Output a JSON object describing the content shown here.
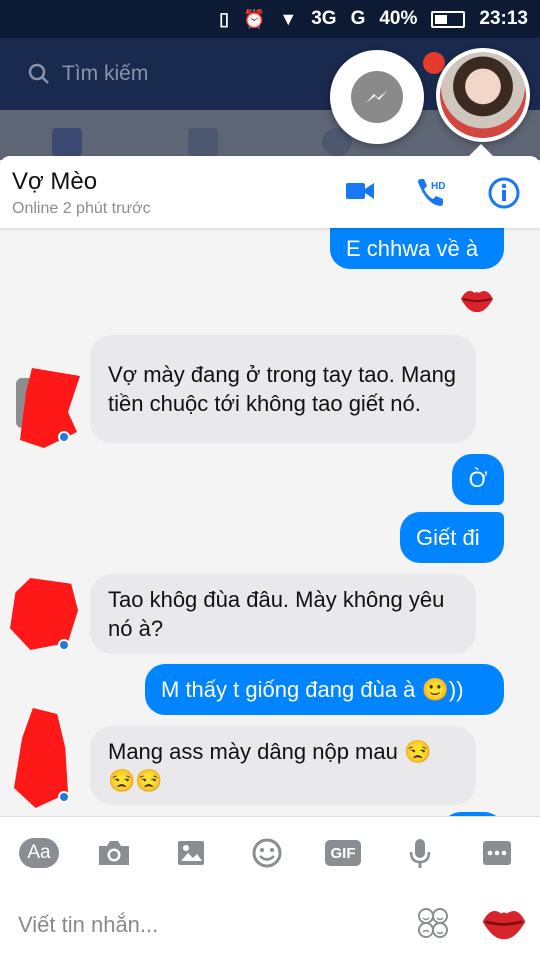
{
  "status_bar": {
    "network": "3G",
    "network2": "G",
    "battery": "40%",
    "time": "23:13"
  },
  "background": {
    "search_placeholder": "Tìm kiếm"
  },
  "chat_header": {
    "name": "Vợ Mèo",
    "status": "Online 2 phút trước"
  },
  "messages": [
    {
      "sender": "me",
      "text": "E chhwa về à"
    },
    {
      "sender": "me",
      "sticker": "kiss-lips"
    },
    {
      "sender": "them",
      "text": "Vợ mày đang ở trong tay tao. Mang tiền chuộc tới không tao giết nó."
    },
    {
      "sender": "me",
      "text": "Ờ"
    },
    {
      "sender": "me",
      "text": "Giết đi"
    },
    {
      "sender": "them",
      "text": "Tao khôg đùa đâu. Mày không yêu nó à?"
    },
    {
      "sender": "me",
      "text": "M thấy t giống đang đùa à 🙂))"
    },
    {
      "sender": "them",
      "text": "Mang ass mày dâng nộp mau 😒😒😒"
    }
  ],
  "toolbar": {
    "aa_label": "Aa",
    "gif_label": "GIF",
    "icons": [
      "text-format-icon",
      "camera-icon",
      "image-icon",
      "emoji-icon",
      "gif-icon",
      "microphone-icon",
      "more-icon"
    ]
  },
  "composer": {
    "placeholder": "Viết tin nhắn..."
  },
  "colors": {
    "accent": "#0084ff",
    "incoming": "#e9e9ec",
    "header_dark": "#1a2a4e"
  }
}
